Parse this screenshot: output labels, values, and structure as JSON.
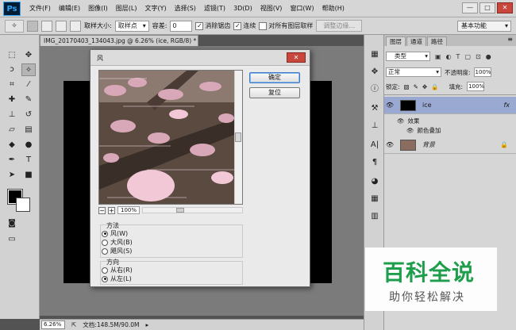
{
  "app": {
    "logo": "Ps"
  },
  "menu": [
    "文件(F)",
    "编辑(E)",
    "图像(I)",
    "图层(L)",
    "文字(Y)",
    "选择(S)",
    "滤镜(T)",
    "3D(D)",
    "视图(V)",
    "窗口(W)",
    "帮助(H)"
  ],
  "window_controls": {
    "minimize": "—",
    "restore": "□",
    "close": "✕"
  },
  "options": {
    "sample_size_label": "取样大小:",
    "sample_size_value": "取样点",
    "tolerance_label": "容差:",
    "tolerance_value": "0",
    "antialias_label": "消除锯齿",
    "antialias_checked": true,
    "contiguous_label": "连续",
    "contiguous_checked": true,
    "sample_all_label": "对所有图层取样",
    "sample_all_checked": false,
    "refine_edge_label": "调整边缘...",
    "workspace_value": "基本功能"
  },
  "document": {
    "tab_title": "IMG_20170403_134043.jpg @ 6.26% (ice, RGB/8) *",
    "zoom": "6.26%",
    "doc_info": "文档:148.5M/90.0M"
  },
  "dialog": {
    "title": "风",
    "ok_label": "确定",
    "reset_label": "复位",
    "preview_zoom": "100%",
    "method_label": "方法",
    "method_options": [
      {
        "label": "风(W)",
        "selected": true
      },
      {
        "label": "大风(B)",
        "selected": false
      },
      {
        "label": "飓风(S)",
        "selected": false
      }
    ],
    "direction_label": "方向",
    "direction_options": [
      {
        "label": "从右(R)",
        "selected": false
      },
      {
        "label": "从左(L)",
        "selected": true
      }
    ]
  },
  "layers_panel": {
    "tabs": [
      "图层",
      "通道",
      "路径"
    ],
    "active_tab": "图层",
    "filter_value": "类型",
    "blend_mode": "正常",
    "opacity_label": "不透明度:",
    "opacity_value": "100%",
    "lock_label": "锁定:",
    "fill_label": "填充:",
    "fill_value": "100%",
    "layers": [
      {
        "name": "ice",
        "selected": true,
        "fx": "fx"
      },
      {
        "name": "背景",
        "selected": false,
        "locked": true
      }
    ],
    "effects_label": "效果",
    "effect_item": "颜色叠加"
  },
  "watermark": {
    "title": "百科全说",
    "subtitle": "助你轻松解决"
  },
  "colors": {
    "accent_selected_layer": "#9aa9d2",
    "watermark_green": "#1e9e4c"
  }
}
